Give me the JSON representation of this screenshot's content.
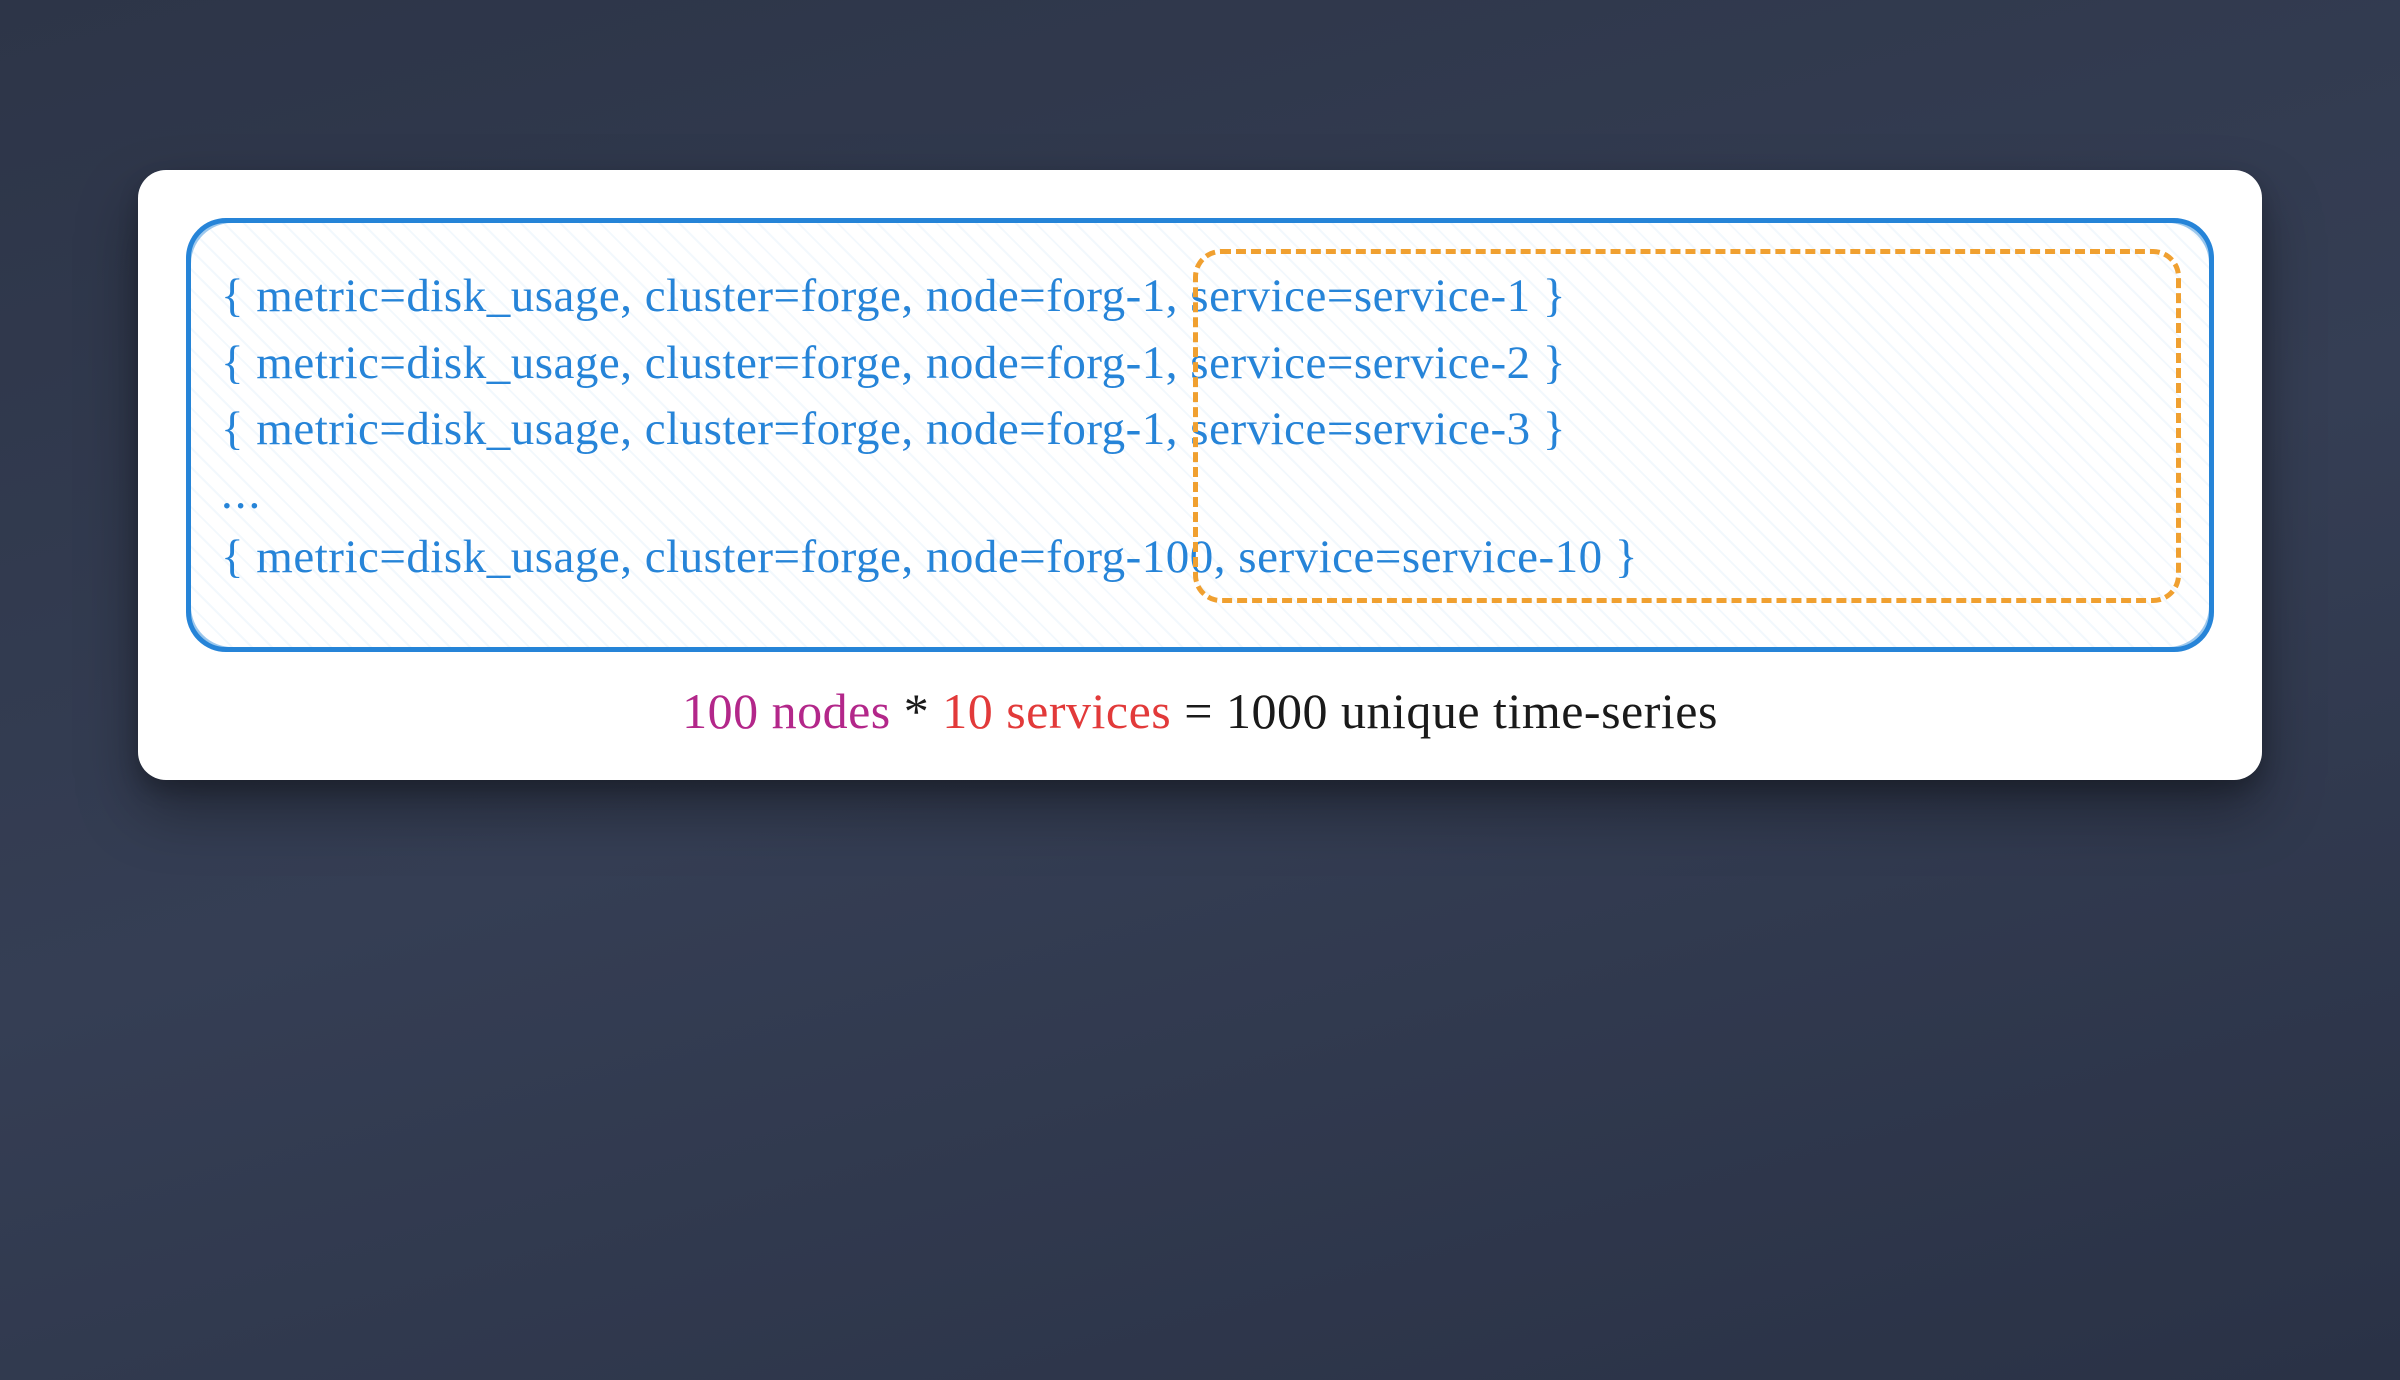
{
  "rows": [
    "{ metric=disk_usage, cluster=forge, node=forg-1, service=service-1 }",
    "{ metric=disk_usage, cluster=forge, node=forg-1, service=service-2 }",
    "{ metric=disk_usage, cluster=forge, node=forg-1, service=service-3 }"
  ],
  "ellipsis": "...",
  "last_row": "{ metric=disk_usage, cluster=forge, node=forg-100, service=service-10 }",
  "caption": {
    "nodes": "100 nodes",
    "star": " * ",
    "services": "10 services",
    "equals": " = ",
    "result": "1000 unique time-series"
  },
  "colors": {
    "blue": "#2684d8",
    "orange": "#f0a030",
    "purple": "#b3278a",
    "red": "#e23a3a",
    "black": "#1a1a1a"
  }
}
